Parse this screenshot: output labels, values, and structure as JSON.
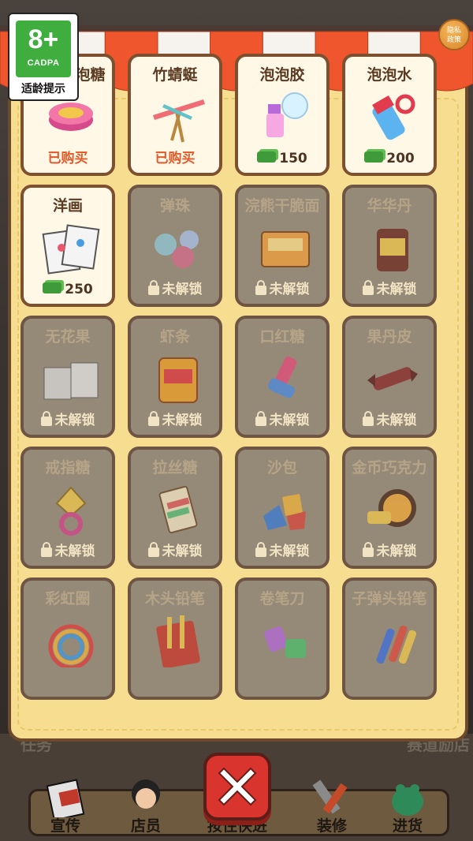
{
  "age_badge": {
    "rating": "8+",
    "org": "CADPA",
    "label": "适龄提示"
  },
  "privacy": {
    "line1": "隐私",
    "line2": "政策"
  },
  "shop": {
    "items": [
      {
        "name": "小小泡泡糖",
        "status": "bought",
        "label": "已购买",
        "icon": "bubble-gum-tin-icon"
      },
      {
        "name": "竹蜻蜓",
        "status": "bought",
        "label": "已购买",
        "icon": "bamboo-dragonfly-icon"
      },
      {
        "name": "泡泡胶",
        "status": "buyable",
        "price": "150",
        "icon": "bubble-glue-icon"
      },
      {
        "name": "泡泡水",
        "status": "buyable",
        "price": "200",
        "icon": "bubble-water-icon"
      },
      {
        "name": "洋画",
        "status": "buyable",
        "price": "250",
        "icon": "picture-cards-icon"
      },
      {
        "name": "弹珠",
        "status": "locked",
        "label": "未解锁",
        "icon": "marbles-icon"
      },
      {
        "name": "浣熊干脆面",
        "status": "locked",
        "label": "未解锁",
        "icon": "noodle-snack-icon"
      },
      {
        "name": "华华丹",
        "status": "locked",
        "label": "未解锁",
        "icon": "candy-box-icon"
      },
      {
        "name": "无花果",
        "status": "locked",
        "label": "未解锁",
        "icon": "fig-snack-icon"
      },
      {
        "name": "虾条",
        "status": "locked",
        "label": "未解锁",
        "icon": "shrimp-snack-icon"
      },
      {
        "name": "口红糖",
        "status": "locked",
        "label": "未解锁",
        "icon": "lipstick-candy-icon"
      },
      {
        "name": "果丹皮",
        "status": "locked",
        "label": "未解锁",
        "icon": "fruit-roll-icon"
      },
      {
        "name": "戒指糖",
        "status": "locked",
        "label": "未解锁",
        "icon": "ring-candy-icon"
      },
      {
        "name": "拉丝糖",
        "status": "locked",
        "label": "未解锁",
        "icon": "stretch-candy-icon"
      },
      {
        "name": "沙包",
        "status": "locked",
        "label": "未解锁",
        "icon": "sandbag-icon"
      },
      {
        "name": "金币巧克力",
        "status": "locked",
        "label": "未解锁",
        "icon": "coin-chocolate-icon"
      },
      {
        "name": "彩虹圈",
        "status": "locked",
        "label": "",
        "icon": "rainbow-spring-icon"
      },
      {
        "name": "木头铅笔",
        "status": "locked",
        "label": "",
        "icon": "wooden-pencil-icon"
      },
      {
        "name": "卷笔刀",
        "status": "locked",
        "label": "",
        "icon": "pencil-sharpener-icon"
      },
      {
        "name": "子弹头铅笔",
        "status": "locked",
        "label": "",
        "icon": "bullet-pencil-icon"
      }
    ]
  },
  "background": {
    "left_text": "任务",
    "right_text": "赛道励店"
  },
  "nav": [
    {
      "label": "宣传",
      "icon": "promotion-book-icon"
    },
    {
      "label": "店员",
      "icon": "clerk-avatar-icon"
    },
    {
      "label": "按住快进",
      "icon": "fast-forward-icon"
    },
    {
      "label": "装修",
      "icon": "decorate-tools-icon"
    },
    {
      "label": "进货",
      "icon": "restock-frog-icon"
    }
  ],
  "close_icon": "close-x-icon",
  "colors": {
    "awning_red": "#f0562d",
    "awning_white": "#f6f3ee",
    "panel": "#f7dd8f",
    "locked_tile": "#958977",
    "bought_text": "#e35a2a",
    "close_red": "#d9352e"
  }
}
